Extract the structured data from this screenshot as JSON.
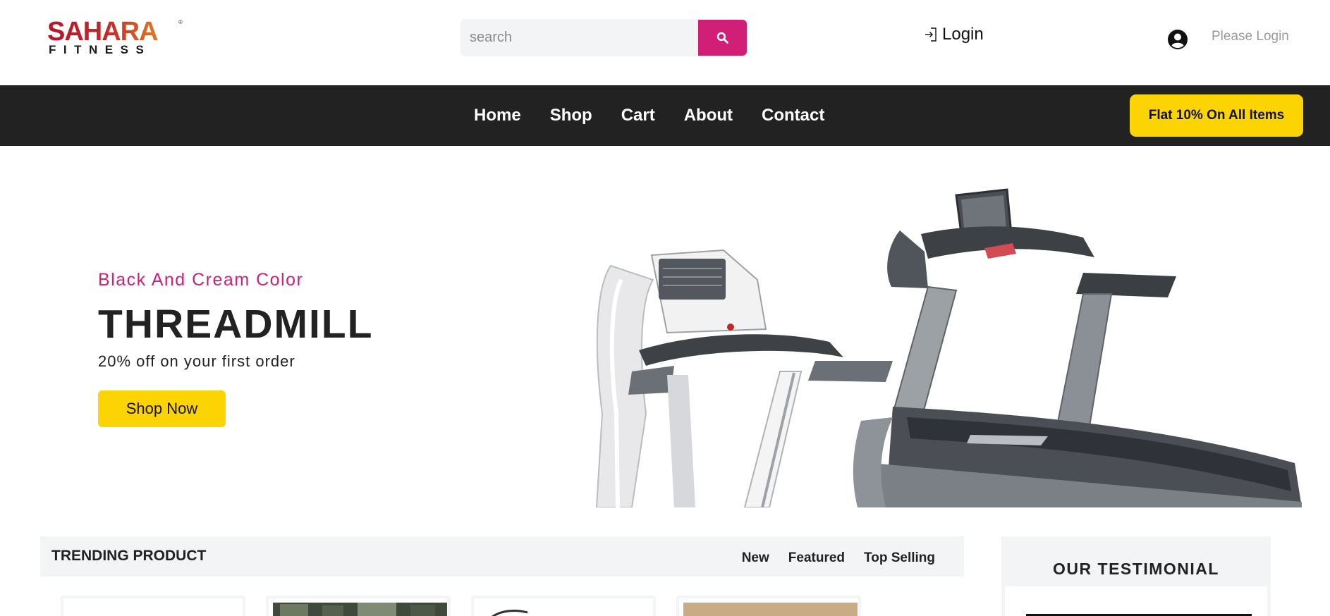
{
  "brand": {
    "name": "SAHARA",
    "tagline": "FITNESS",
    "registered_mark": "®"
  },
  "search": {
    "placeholder": "search",
    "value": "",
    "button_icon": "search-icon"
  },
  "header": {
    "login_label": "Login",
    "login_icon": "sign-in-icon",
    "user_status": "Please Login",
    "user_icon": "user-circle-icon"
  },
  "nav": {
    "links": [
      {
        "label": "Home"
      },
      {
        "label": "Shop"
      },
      {
        "label": "Cart"
      },
      {
        "label": "About"
      },
      {
        "label": "Contact"
      }
    ],
    "promo_label": "Flat 10% On All Items"
  },
  "hero": {
    "subtitle": "Black And Cream Color",
    "title": "THREADMILL",
    "offer": "20% off on your first order",
    "cta_label": "Shop Now"
  },
  "trending": {
    "title": "TRENDING PRODUCT",
    "tabs": [
      "New",
      "Featured",
      "Top Selling"
    ]
  },
  "testimonial": {
    "title": "OUR TESTIMONIAL"
  },
  "colors": {
    "accent_pink": "#d11f78",
    "accent_yellow": "#fcd404",
    "nav_dark": "#222222",
    "panel_gray": "#f3f4f6"
  }
}
